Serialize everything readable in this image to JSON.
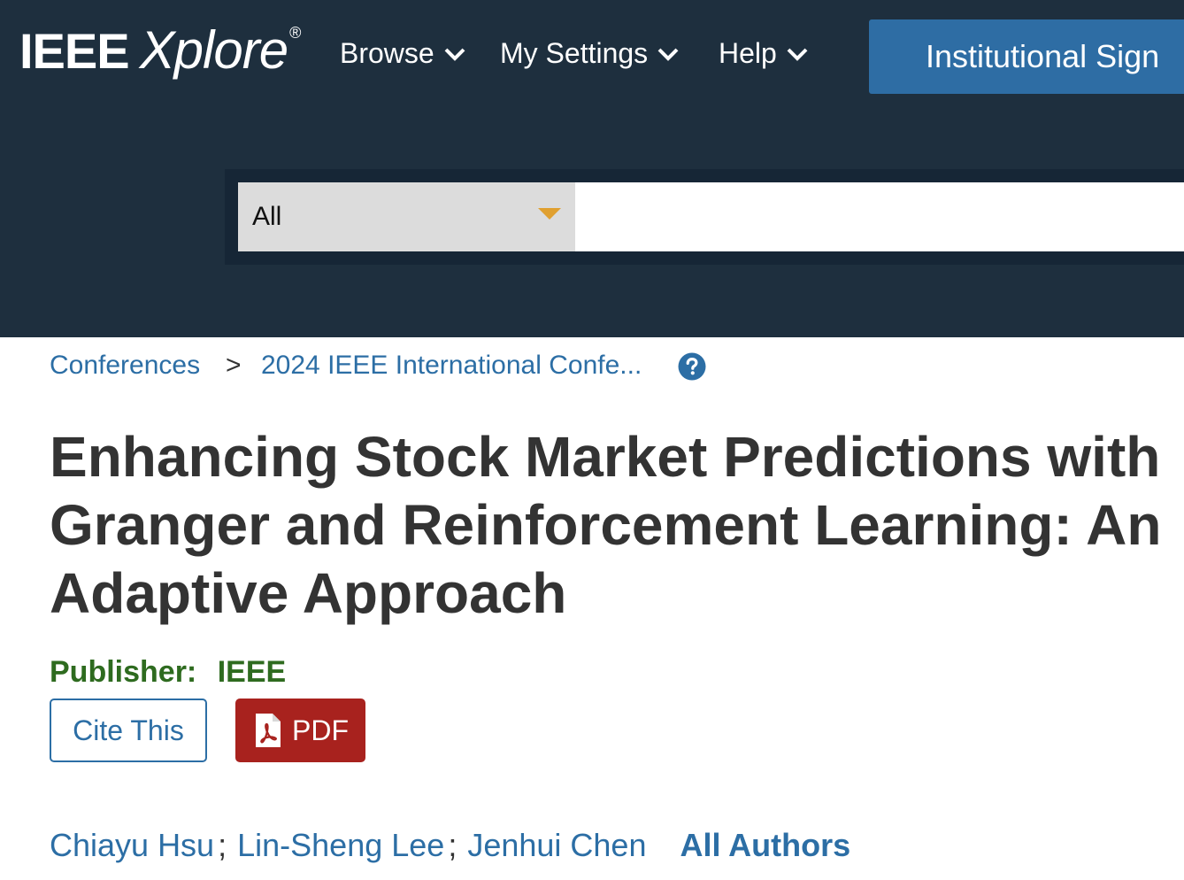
{
  "header": {
    "logo": {
      "brand": "IEEE",
      "product": "Xplore",
      "mark": "®"
    },
    "nav": [
      {
        "label": "Browse",
        "icon": "chevron-down-icon"
      },
      {
        "label": "My Settings",
        "icon": "chevron-down-icon"
      },
      {
        "label": "Help",
        "icon": "chevron-down-icon"
      }
    ],
    "signin_label": "Institutional Sign",
    "colors": {
      "background": "#1e2f3e",
      "signin": "#2e6da4"
    }
  },
  "search": {
    "scope_value": "All",
    "scope_icon": "caret-down-icon",
    "query_value": ""
  },
  "breadcrumb": {
    "items": [
      "Conferences",
      "2024 IEEE International Confe..."
    ],
    "separator": ">",
    "help_icon": "question-circle-icon"
  },
  "article": {
    "title": "Enhancing Stock Market Predictions with Granger and Reinforcement Learning: An Adaptive Approach",
    "publisher_label": "Publisher:",
    "publisher_name": "IEEE",
    "cite_label": "Cite This",
    "pdf_label": "PDF",
    "pdf_icon": "acrobat-pdf-icon",
    "authors": [
      "Chiayu Hsu",
      "Lin-Sheng Lee",
      "Jenhui Chen"
    ],
    "author_separator": ";",
    "all_authors_label": "All Authors",
    "colors": {
      "link": "#2c6ea5",
      "publisher": "#2e6b1f",
      "pdf": "#a8221e"
    }
  }
}
